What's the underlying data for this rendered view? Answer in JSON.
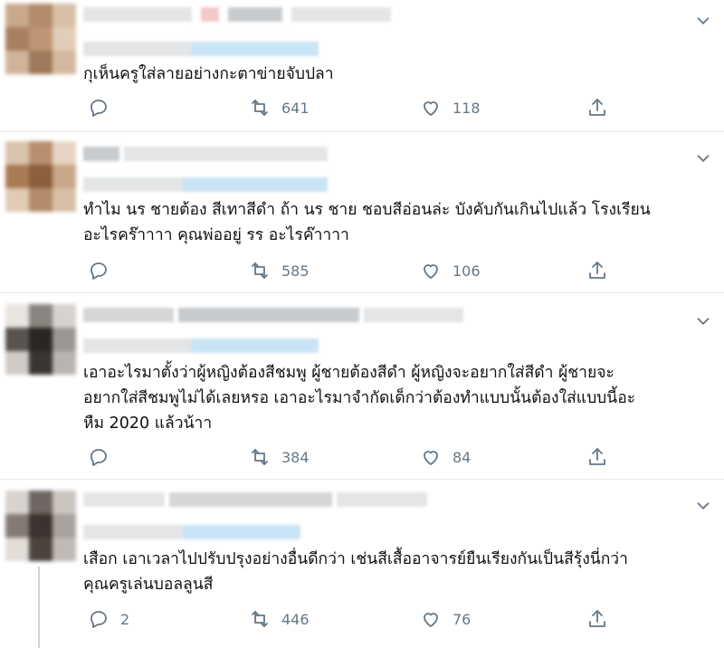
{
  "tweets": [
    {
      "text_lines": [
        "กุเห็นครูใส่ลายอย่างกะตาข่ายจับปลา"
      ],
      "reply_count": "",
      "retweet_count": "641",
      "like_count": "118",
      "avatar_colors": [
        "#c9a98c",
        "#b48a6b",
        "#d8c0a8",
        "#a7805f",
        "#bf9674",
        "#e2cdb8",
        "#cfb49a",
        "#9e7a5a",
        "#d4b9a0"
      ]
    },
    {
      "text_lines": [
        "ทำไม นร ชายต้อง สีเทาสีดำ ถ้า นร ชาย ชอบสีอ่อนล่ะ บังคับกันเกินไปแล้ว โรงเรียน",
        "อะไรคร๊าาาา คุณพ่ออยู่ รร อะไรค๊าาาา"
      ],
      "reply_count": "",
      "retweet_count": "585",
      "like_count": "106",
      "avatar_colors": [
        "#d9c3ad",
        "#b8906e",
        "#e6d5c3",
        "#a97b55",
        "#8c5f3d",
        "#c9a688",
        "#e0cbb4",
        "#b58c6a",
        "#d8bfa6"
      ]
    },
    {
      "text_lines": [
        "เอาอะไรมาตั้งว่าผู้หญิงต้องสีชมพู ผู้ชายต้องสีดำ ผู้หญิงจะอยากใส่สีดำ ผู้ชายจะ",
        "อยากใส่สีชมพูไม่ได้เลยหรอ เอาอะไรมาจำกัดเด็กว่าต้องทำแบบนั้นต้องใส่แบบนี้อะ",
        "หืม 2020 แล้วน้าา"
      ],
      "reply_count": "",
      "retweet_count": "384",
      "like_count": "84",
      "avatar_colors": [
        "#e8e4e0",
        "#8a8580",
        "#d6d2ce",
        "#5a5450",
        "#2b2623",
        "#9c9792",
        "#cfcac5",
        "#3b3531",
        "#b9b4af"
      ]
    },
    {
      "text_lines": [
        "เสือก เอาเวลาไปปรับปรุงอย่างอื่นดีกว่า เช่นสีเสื้ออาจารย์ยืนเรียงกันเป็นสีรุ้งนี่กว่า",
        "คุณครูเล่นบอลลูนสี"
      ],
      "reply_count": "2",
      "retweet_count": "446",
      "like_count": "76",
      "avatar_colors": [
        "#d8d3cf",
        "#6e6661",
        "#cbc5c0",
        "#837a74",
        "#3a332f",
        "#a9a29d",
        "#e2ddd9",
        "#4b433e",
        "#c0bab5"
      ]
    }
  ],
  "icons": {
    "reply": "reply-icon",
    "retweet": "retweet-icon",
    "like": "heart-icon",
    "share": "share-icon",
    "more": "chevron-down-icon"
  },
  "colors": {
    "icon_gray": "#657786",
    "divider": "#e6ecf0",
    "blur_link": "#c9e4f6",
    "blur_gray": "#d7d9db"
  }
}
